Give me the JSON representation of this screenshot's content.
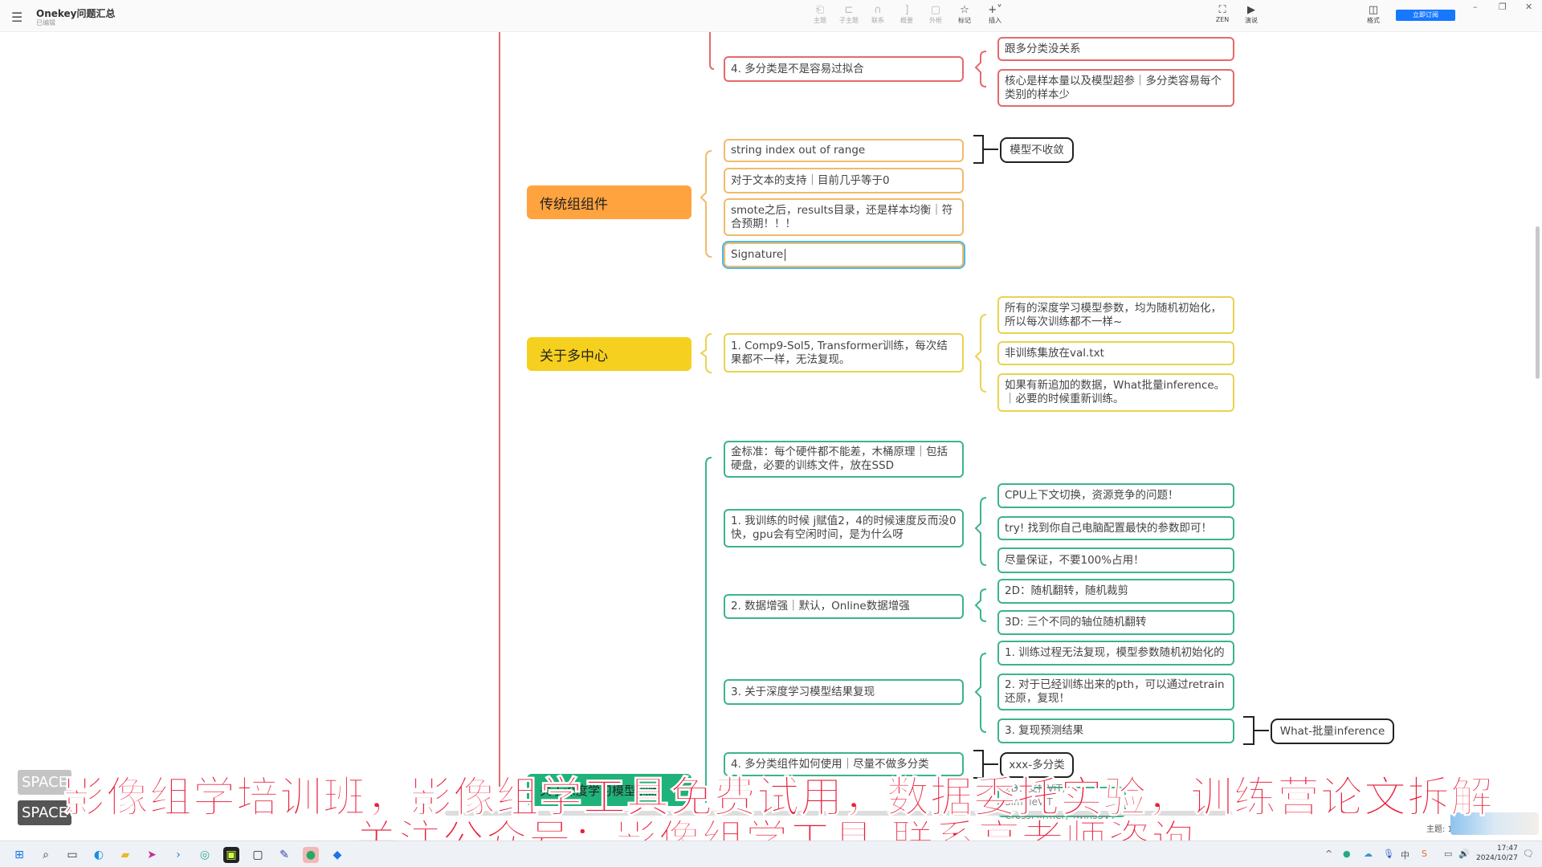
{
  "app": {
    "title": "Onekey问题汇总",
    "status": "已编辑",
    "menu_icon": "hamburger-icon"
  },
  "toolbar": {
    "items": [
      {
        "label": "主题",
        "icon": "topic-icon"
      },
      {
        "label": "子主题",
        "icon": "subtopic-icon"
      },
      {
        "label": "联系",
        "icon": "relation-icon"
      },
      {
        "label": "概要",
        "icon": "summary-icon"
      },
      {
        "label": "外框",
        "icon": "boundary-icon"
      },
      {
        "label": "标记",
        "icon": "star-icon"
      },
      {
        "label": "插入",
        "icon": "plus-icon"
      }
    ],
    "zen": "ZEN",
    "present": "演说",
    "format": "格式",
    "subscribe": "立即订阅"
  },
  "colors": {
    "red_branch": "#e46a6a",
    "orange_branch": "#f0bb6c",
    "yellow_branch": "#e9d34f",
    "green_branch": "#3bb48c",
    "cat_orange": "#ffa33f",
    "cat_yellow": "#f6d01f",
    "cat_green": "#1fb27a",
    "subscribe": "#1677ff",
    "subtitle": "#e8203c"
  },
  "mindmap": {
    "red": {
      "l2": [
        "4. 多分类是不是容易过拟合"
      ],
      "l3": [
        "跟多分类没关系",
        "核心是样本量以及模型超参｜多分类容易每个类别的样本少"
      ]
    },
    "orange": {
      "category": "传统组组件",
      "l2": [
        "string index out of range",
        "对于文本的支持｜目前几乎等于0",
        "smote之后，results目录，还是样本均衡｜符合预期！！！",
        "Signature"
      ],
      "summary": "模型不收敛"
    },
    "yellow": {
      "category": "关于多中心",
      "l2": [
        "1. Comp9-Sol5, Transformer训练，每次结果都不一样，无法复现。"
      ],
      "l3": [
        "所有的深度学习模型参数，均为随机初始化，所以每次训练都不一样~",
        "非训练集放在val.txt",
        "如果有新追加的数据，What批量inference。｜必要的时候重新训练。"
      ]
    },
    "green": {
      "category": "关于深度学习模型训练",
      "l2": [
        "金标准：每个硬件都不能差，木桶原理｜包括硬盘，必要的训练文件，放在SSD",
        "1. 我训练的时候 j赋值2，4的时候速度反而没0快，gpu会有空闲时间，是为什么呀",
        "2. 数据增强｜默认，Online数据增强",
        "3. 关于深度学习模型结果复现",
        "4. 多分类组件如何使用｜尽量不做多分类",
        "2D：支持ViT, SimpleViT, CrossFormer, TwinsSVT"
      ],
      "l3": [
        "CPU上下文切换，资源竞争的问题！",
        "try! 找到你自己电脑配置最快的参数即可！",
        "尽量保证，不要100%占用！",
        "2D：随机翻转，随机裁剪",
        "3D: 三个不同的轴位随机翻转",
        "1. 训练过程无法复现，模型参数随机初始化的",
        "2. 对于已经训练出来的pth，可以通过retrain还原，复现！",
        "3. 复现预测结果"
      ],
      "summaries": [
        "What-批量inference",
        "xxx-多分类"
      ]
    }
  },
  "overlay": {
    "space_keys": [
      "SPACE",
      "SPACE"
    ],
    "subtitle_line1": "影像组学培训班，影像组学工具免费试用，数据委托实验，训练营论文拆解",
    "subtitle_line2": "关注公众号：影像组学工具 联系高老师咨询"
  },
  "statusbar": {
    "topic_count": "主题: 1"
  },
  "taskbar": {
    "time": "17:47",
    "date": "2024/10/27"
  }
}
